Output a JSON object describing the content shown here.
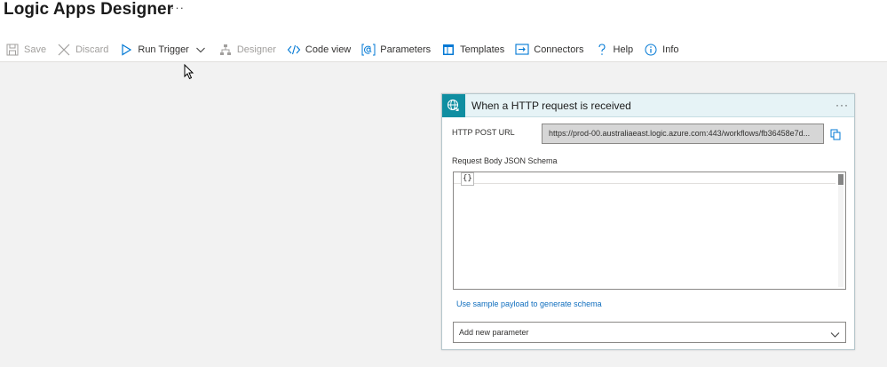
{
  "page": {
    "title": "Logic Apps Designer",
    "more_label": "···"
  },
  "toolbar": {
    "save": "Save",
    "discard": "Discard",
    "run_trigger": "Run Trigger",
    "designer": "Designer",
    "code_view": "Code view",
    "parameters": "Parameters",
    "templates": "Templates",
    "connectors": "Connectors",
    "help": "Help",
    "info": "Info"
  },
  "trigger_card": {
    "title": "When a HTTP request is received",
    "more_label": "···",
    "http_post_url_label": "HTTP POST URL",
    "http_post_url_value": "https://prod-00.australiaeast.logic.azure.com:443/workflows/fb36458e7d...",
    "schema_label": "Request Body JSON Schema",
    "schema_value": "{}",
    "sample_link": "Use sample payload to generate schema",
    "add_parameter": "Add new parameter"
  },
  "colors": {
    "accent": "#0078d4",
    "trigger_teal": "#0f8ea1",
    "header_bg": "#e6f3f6",
    "canvas_bg": "#f2f2f2",
    "link": "#106ebe"
  },
  "icons": {
    "save": "save-icon",
    "discard": "close-icon",
    "run_trigger": "play-icon",
    "designer": "hierarchy-icon",
    "code_view": "code-icon",
    "parameters": "at-sign-icon",
    "templates": "template-icon",
    "connectors": "connector-icon",
    "help": "question-icon",
    "info": "info-icon",
    "trigger": "globe-request-icon",
    "copy": "copy-icon",
    "dropdown": "chevron-down-icon"
  }
}
